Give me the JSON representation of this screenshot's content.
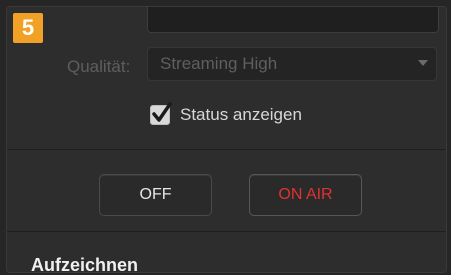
{
  "step_badge": "5",
  "quality": {
    "label": "Qualität:",
    "selected": "Streaming High",
    "dropdown_icon": "chevron-down-icon"
  },
  "status": {
    "label": "Status anzeigen",
    "checked": true,
    "check_icon": "checkmark-icon"
  },
  "buttons": {
    "off": "OFF",
    "on_air": "ON AIR"
  },
  "section": {
    "title": "Aufzeichnen"
  },
  "colors": {
    "badge": "#f0a126",
    "on_air_text": "#e2312f",
    "background": "#2d2d2d"
  }
}
